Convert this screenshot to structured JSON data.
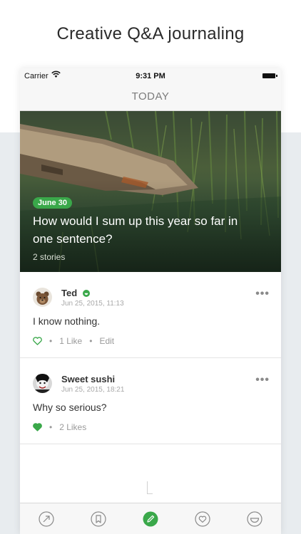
{
  "headline": "Creative Q&A journaling",
  "status": {
    "carrier": "Carrier",
    "time": "9:31 PM"
  },
  "nav": {
    "title": "TODAY"
  },
  "hero": {
    "date": "June 30",
    "question": "How would I sum up this year so far in one sentence?",
    "stories": "2 stories"
  },
  "posts": [
    {
      "name": "Ted",
      "date": "Jun 25, 2015, 11:13",
      "text": "I know nothing.",
      "likes": "1 Like",
      "edit": "Edit",
      "liked": false,
      "mood_icon": "smile-badge-icon"
    },
    {
      "name": "Sweet sushi",
      "date": "Jun 25, 2015, 18:21",
      "text": "Why so serious?",
      "likes": "2 Likes",
      "liked": true
    }
  ],
  "tabbar": {
    "items": [
      "share-icon",
      "bookmark-icon",
      "compose-icon",
      "heart-icon",
      "smile-icon"
    ],
    "active": "compose-icon"
  },
  "colors": {
    "accent": "#3aa84a",
    "background": "#e8ecef"
  }
}
